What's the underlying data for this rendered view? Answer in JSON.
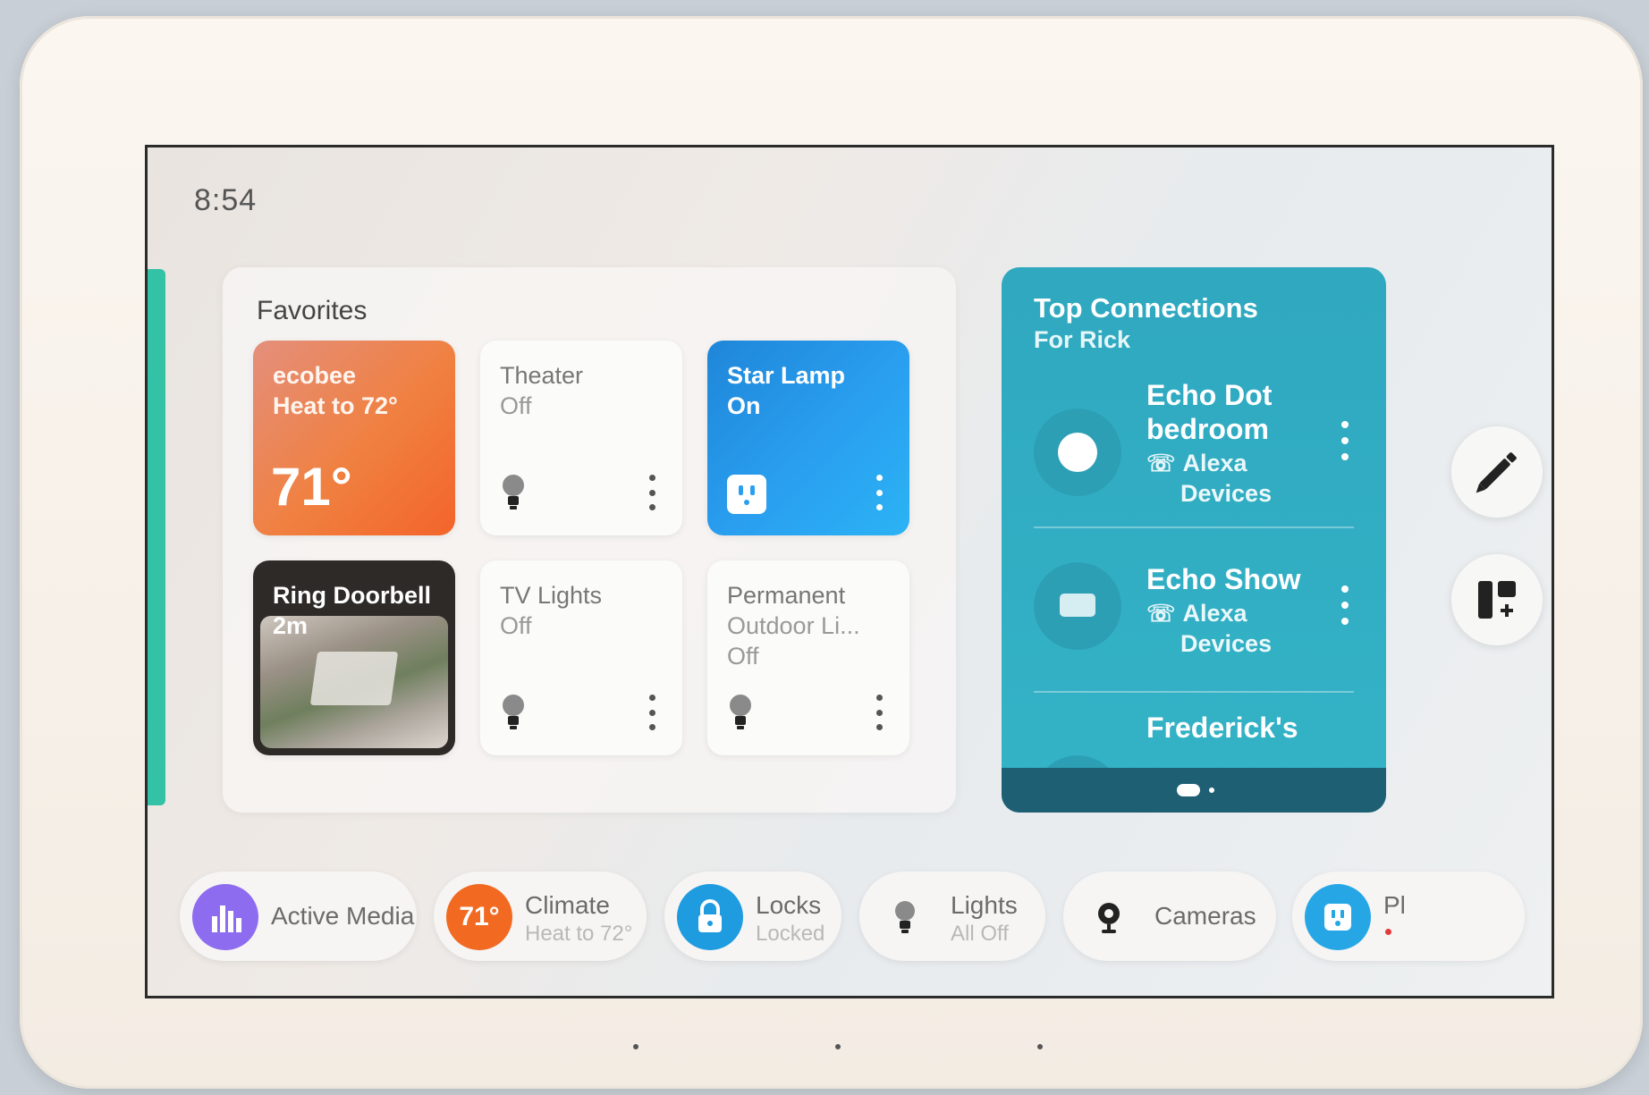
{
  "clock": "8:54",
  "favorites": {
    "title": "Favorites",
    "tiles": [
      {
        "name": "ecobee",
        "state": "Heat to 72°",
        "temp": "71°"
      },
      {
        "name": "Theater",
        "state": "Off"
      },
      {
        "name": "Star Lamp",
        "state": "On"
      },
      {
        "name": "Ring Doorbell",
        "state": "2m"
      },
      {
        "name": "TV Lights",
        "state": "Off"
      },
      {
        "name": "Permanent",
        "name2": "Outdoor Li...",
        "state": "Off"
      }
    ]
  },
  "connections": {
    "title": "Top Connections",
    "subtitle": "For Rick",
    "items": [
      {
        "name_line1": "Echo Dot",
        "name_line2": "bedroom",
        "meta_line1": "Alexa",
        "meta_line2": "Devices"
      },
      {
        "name_line1": "Echo Show",
        "meta_line1": "Alexa",
        "meta_line2": "Devices"
      },
      {
        "name_line1": "Frederick's"
      }
    ]
  },
  "chips": {
    "active_media": {
      "label": "Active Media"
    },
    "climate": {
      "label": "Climate",
      "sub": "Heat to 72°",
      "badge": "71°"
    },
    "locks": {
      "label": "Locks",
      "sub": "Locked"
    },
    "lights": {
      "label": "Lights",
      "sub": "All Off"
    },
    "cameras": {
      "label": "Cameras"
    },
    "plugs": {
      "label": "Pl"
    }
  },
  "colors": {
    "ecobee": "#f08040",
    "star_lamp": "#2a9ff0",
    "connections": "#34b3c6",
    "accent_green": "#33c2a6",
    "active_media": "#8e6cf0",
    "climate": "#f26a22",
    "locks": "#1f9be0",
    "plugs": "#27a6e6"
  }
}
